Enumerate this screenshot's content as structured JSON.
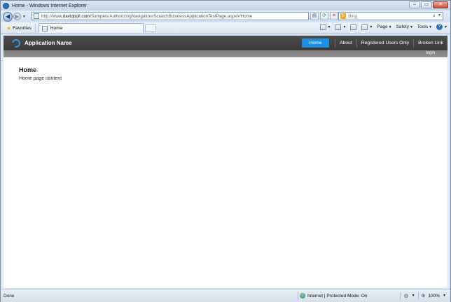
{
  "window": {
    "title": "Home - Windows Internet Explorer",
    "controls": {
      "minimize": "‒",
      "maximize": "▭",
      "close": "✕"
    }
  },
  "addressbar": {
    "url_prefix": "http://www.",
    "url_domain": "davidpoll.com",
    "url_path": "/Samples/AuthorizingNavigation/ScratchBusinessApplicationTestPage.aspx#/Home",
    "search_placeholder": "Bing"
  },
  "favoritesbar": {
    "favorites_label": "Favorites",
    "tab_label": "Home"
  },
  "commandbar": {
    "page_label": "Page",
    "safety_label": "Safety",
    "tools_label": "Tools"
  },
  "app": {
    "name": "Application Name",
    "menu": [
      {
        "label": "Home",
        "active": true
      },
      {
        "label": "About",
        "active": false
      },
      {
        "label": "Registered Users Only",
        "active": false
      },
      {
        "label": "Broken Link",
        "active": false
      }
    ],
    "login_label": "login",
    "page_title": "Home",
    "page_content": "Home page content",
    "accent_color": "#1c8fe0",
    "header_color": "#3f3f3f"
  },
  "statusbar": {
    "status": "Done",
    "zone": "Internet | Protected Mode: On",
    "zoom": "100%"
  }
}
